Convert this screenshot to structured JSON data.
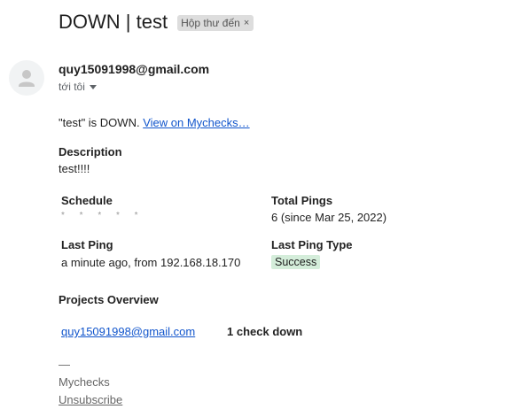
{
  "email": {
    "subject": "DOWN | test",
    "label": "Hộp thư đến",
    "label_remove": "×",
    "sender": "quy15091998@gmail.com",
    "to": "tới tôi",
    "avatar_icon": "person-icon"
  },
  "body": {
    "status_prefix": "\"test\" is DOWN. ",
    "view_link": "View on Mychecks…",
    "description_heading": "Description",
    "description": "test!!!!",
    "schedule_label": "Schedule",
    "schedule_value": "* * * * *",
    "total_pings_label": "Total Pings",
    "total_pings_value": "6 (since Mar 25, 2022)",
    "last_ping_label": "Last Ping",
    "last_ping_value": "a minute ago, from 192.168.18.170",
    "last_ping_type_label": "Last Ping Type",
    "last_ping_type_value": "Success",
    "last_ping_type_color": "#d4edda",
    "projects_heading": "Projects Overview",
    "project_name": "quy15091998@gmail.com",
    "project_status": "1 check down"
  },
  "footer": {
    "separator": "—",
    "brand": "Mychecks",
    "unsubscribe": "Unsubscribe"
  },
  "colors": {
    "link": "#1155cc",
    "chip_bg": "#dddddd"
  }
}
